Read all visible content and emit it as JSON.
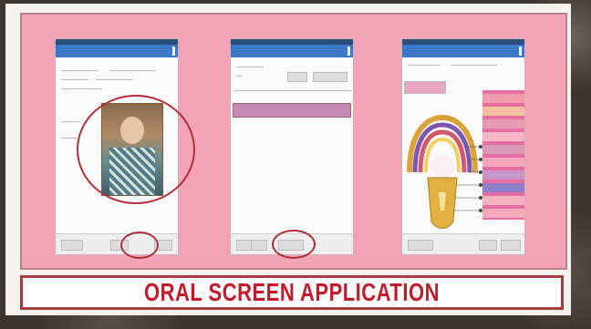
{
  "poster": {
    "title": "ORAL SCREEN APPLICATION"
  },
  "colors": {
    "panel_pink": "#f2a3b6",
    "title_red": "#c21a2b",
    "appbar_blue": "#3c78c8",
    "annotation_ring": "#b0303a"
  },
  "phones": [
    {
      "appbar_icon": "menu-icon"
    },
    {
      "appbar_icon": "menu-icon"
    },
    {
      "appbar_icon": "menu-icon"
    }
  ]
}
